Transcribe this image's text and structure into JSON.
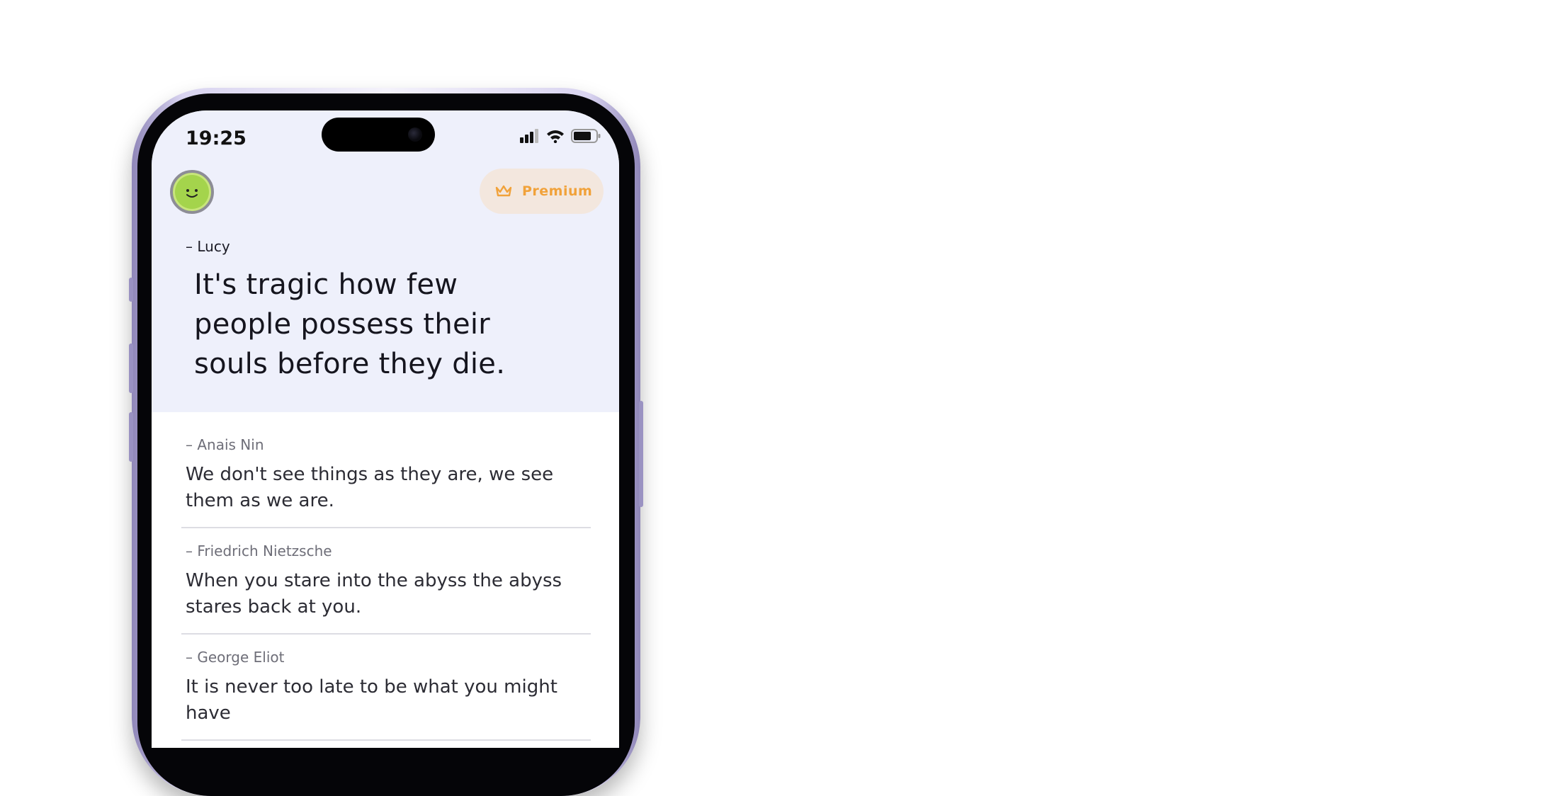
{
  "status_bar": {
    "time": "19:25"
  },
  "header": {
    "premium_label": "Premium"
  },
  "featured": {
    "author": "– Lucy",
    "quote": "It's tragic how few people possess their souls before they die."
  },
  "quotes": [
    {
      "author": "– Anais Nin",
      "text": "We don't see things as they are, we see them as we are."
    },
    {
      "author": "– Friedrich Nietzsche",
      "text": "When you stare into the abyss the abyss stares back at you."
    },
    {
      "author": "– George Eliot",
      "text": "It is never too late to be what you might have"
    }
  ],
  "colors": {
    "hero_bg": "#eef0fb",
    "premium_bg": "#f3e7de",
    "premium_accent": "#f1a23a",
    "avatar": "#a4d44c"
  }
}
